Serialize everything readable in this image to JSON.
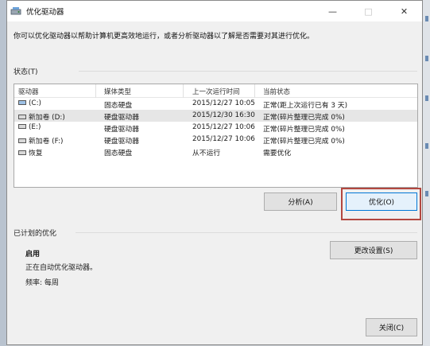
{
  "window": {
    "title": "优化驱动器",
    "controls": [
      "—",
      "□",
      "✕"
    ]
  },
  "description": "你可以优化驱动器以帮助计算机更高效地运行，或者分析驱动器以了解是否需要对其进行优化。",
  "status_section": {
    "label": "状态(T)",
    "columns": [
      "驱动器",
      "媒体类型",
      "上一次运行时间",
      "当前状态"
    ],
    "rows": [
      {
        "drive": "(C:)",
        "media": "固态硬盘",
        "last_run": "2015/12/27 10:05",
        "status": "正常(距上次运行已有 3 天)",
        "icon": "system-drive-icon",
        "selected": false
      },
      {
        "drive": "新加卷 (D:)",
        "media": "硬盘驱动器",
        "last_run": "2015/12/30 16:30",
        "status": "正常(碎片整理已完成 0%)",
        "icon": "drive-icon",
        "selected": true
      },
      {
        "drive": "(E:)",
        "media": "硬盘驱动器",
        "last_run": "2015/12/27 10:06",
        "status": "正常(碎片整理已完成 0%)",
        "icon": "drive-icon",
        "selected": false
      },
      {
        "drive": "新加卷 (F:)",
        "media": "硬盘驱动器",
        "last_run": "2015/12/27 10:06",
        "status": "正常(碎片整理已完成 0%)",
        "icon": "drive-icon",
        "selected": false
      },
      {
        "drive": "恢复",
        "media": "固态硬盘",
        "last_run": "从不运行",
        "status": "需要优化",
        "icon": "drive-icon",
        "selected": false
      }
    ]
  },
  "buttons": {
    "analyze": "分析(A)",
    "optimize": "优化(O)",
    "change_settings": "更改设置(S)",
    "close": "关闭(C)"
  },
  "schedule": {
    "label": "已计划的优化",
    "state": "启用",
    "detail": "正在自动优化驱动器。",
    "frequency": "频率: 每周"
  },
  "colors": {
    "highlight_box": "#b3473f",
    "primary_border": "#0078d7"
  }
}
